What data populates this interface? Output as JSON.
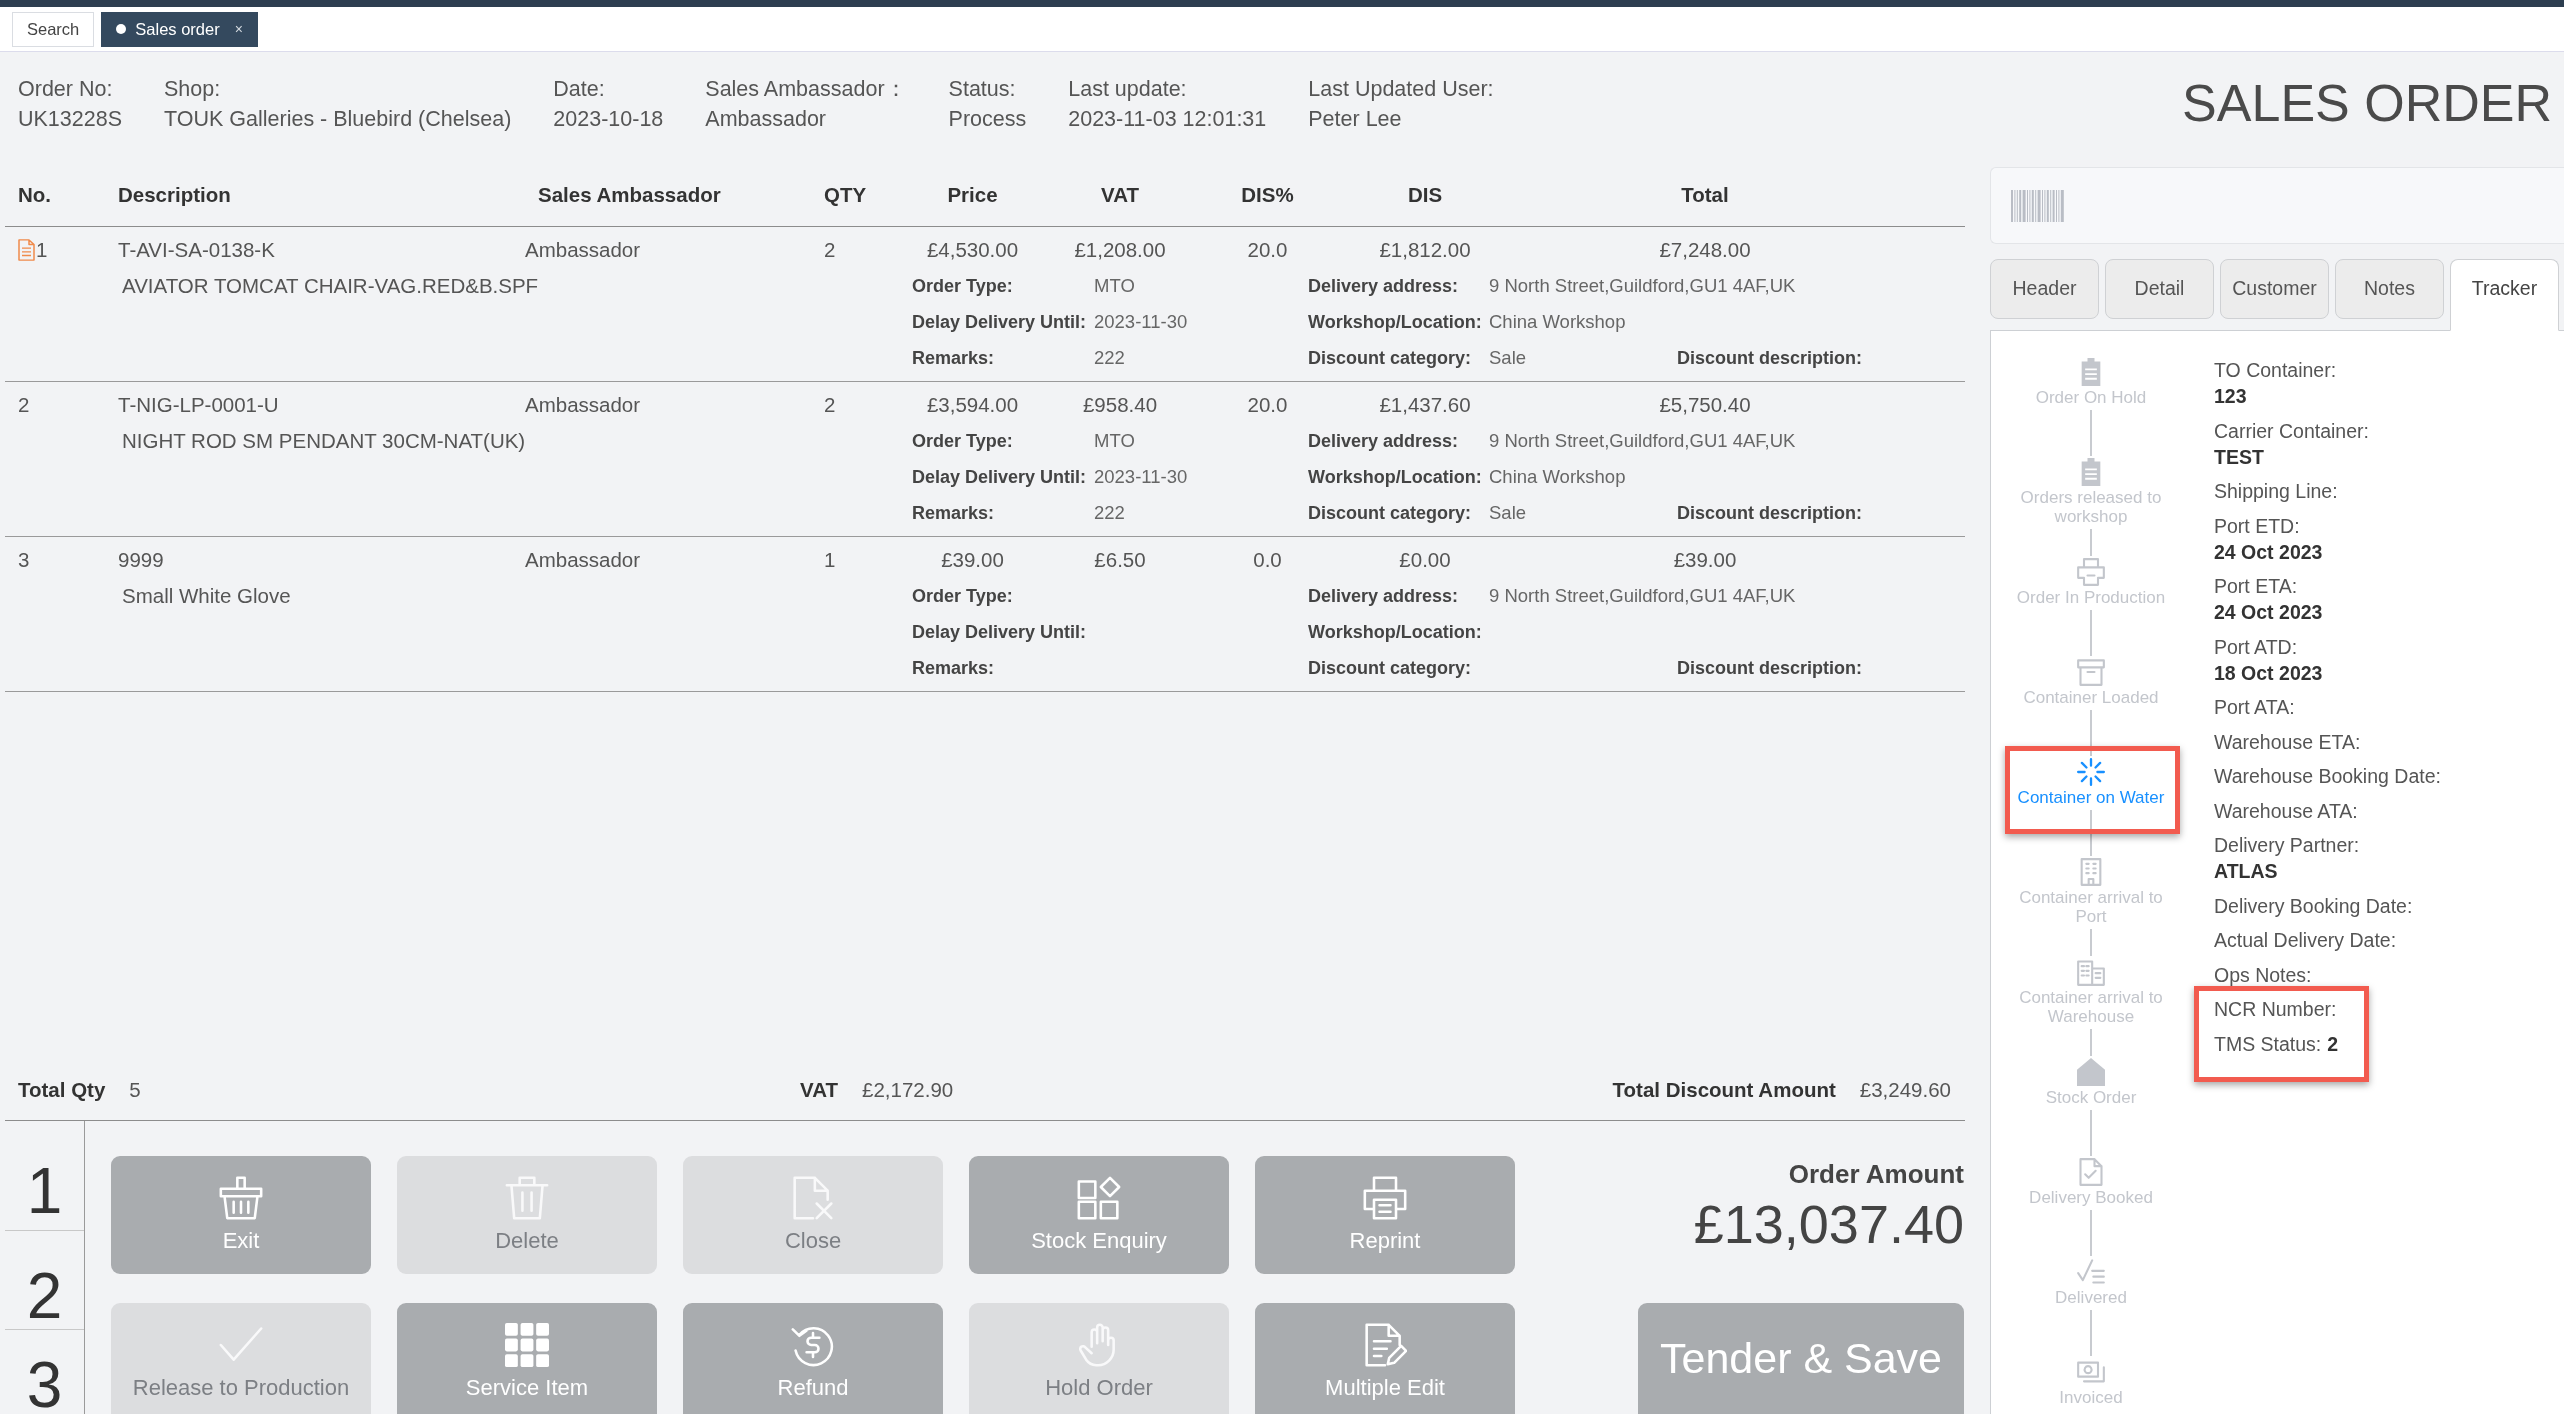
{
  "top_tabs": [
    {
      "label": "Search",
      "selected": false
    },
    {
      "label": "Sales order",
      "selected": true,
      "close": "×"
    }
  ],
  "header": {
    "fields": [
      {
        "label": "Order No:",
        "value": "UK13228S"
      },
      {
        "label": "Shop:",
        "value": "TOUK Galleries - Bluebird (Chelsea)"
      },
      {
        "label": "Date:",
        "value": "2023-10-18"
      },
      {
        "label": "Sales Ambassador：",
        "value": "Ambassador"
      },
      {
        "label": "Status:",
        "value": "Process"
      },
      {
        "label": "Last update:",
        "value": "2023-11-03 12:01:31"
      },
      {
        "label": "Last Updated User:",
        "value": "Peter Lee"
      }
    ],
    "title": "SALES ORDER"
  },
  "table": {
    "columns": [
      "No.",
      "Description",
      "Sales Ambassador",
      "QTY",
      "Price",
      "VAT",
      "DIS%",
      "DIS",
      "Total"
    ],
    "rows": [
      {
        "no": "1",
        "has_note": true,
        "code": "T-AVI-SA-0138-K",
        "description": "AVIATOR TOMCAT CHAIR-VAG.RED&B.SPF",
        "ambassador": "Ambassador",
        "qty": "2",
        "price": "£4,530.00",
        "vat": "£1,208.00",
        "dis_percent": "20.0",
        "dis": "£1,812.00",
        "total": "£7,248.00",
        "details": [
          [
            {
              "label": "Order Type:",
              "value": "MTO"
            },
            {
              "label": "Delivery address:",
              "value": "9 North Street,Guildford,GU1 4AF,UK"
            }
          ],
          [
            {
              "label": "Delay Delivery Until:",
              "value": "2023-11-30"
            },
            {
              "label": "Workshop/Location:",
              "value": "China Workshop"
            }
          ],
          [
            {
              "label": "Remarks:",
              "value": "222"
            },
            {
              "label": "Discount category:",
              "value": "Sale"
            },
            {
              "label": "Discount description:"
            }
          ]
        ]
      },
      {
        "no": "2",
        "has_note": false,
        "code": "T-NIG-LP-0001-U",
        "description": "NIGHT ROD SM PENDANT 30CM-NAT(UK)",
        "ambassador": "Ambassador",
        "qty": "2",
        "price": "£3,594.00",
        "vat": "£958.40",
        "dis_percent": "20.0",
        "dis": "£1,437.60",
        "total": "£5,750.40",
        "details": [
          [
            {
              "label": "Order Type:",
              "value": "MTO"
            },
            {
              "label": "Delivery address:",
              "value": "9 North Street,Guildford,GU1 4AF,UK"
            }
          ],
          [
            {
              "label": "Delay Delivery Until:",
              "value": "2023-11-30"
            },
            {
              "label": "Workshop/Location:",
              "value": "China Workshop"
            }
          ],
          [
            {
              "label": "Remarks:",
              "value": "222"
            },
            {
              "label": "Discount category:",
              "value": "Sale"
            },
            {
              "label": "Discount description:"
            }
          ]
        ]
      },
      {
        "no": "3",
        "has_note": false,
        "code": "9999",
        "description": "Small White Glove",
        "ambassador": "Ambassador",
        "qty": "1",
        "price": "£39.00",
        "vat": "£6.50",
        "dis_percent": "0.0",
        "dis": "£0.00",
        "total": "£39.00",
        "details": [
          [
            {
              "label": "Order Type:"
            },
            {
              "label": "Delivery address:",
              "value": "9 North Street,Guildford,GU1 4AF,UK"
            }
          ],
          [
            {
              "label": "Delay Delivery Until:"
            },
            {
              "label": "Workshop/Location:"
            }
          ],
          [
            {
              "label": "Remarks:"
            },
            {
              "label": "Discount category:"
            },
            {
              "label": "Discount description:"
            }
          ]
        ]
      }
    ]
  },
  "totals": [
    {
      "label": "Total Qty",
      "value": "5"
    },
    {
      "label": "VAT",
      "value": "£2,172.90"
    },
    {
      "label": "Total Discount Amount",
      "value": "£3,249.60"
    }
  ],
  "row_numbers": [
    "1",
    "2",
    "3"
  ],
  "action_rows": [
    [
      {
        "label": "Exit",
        "disabled": false
      },
      {
        "label": "Delete",
        "disabled": true
      },
      {
        "label": "Close",
        "disabled": true
      },
      {
        "label": "Stock Enquiry",
        "disabled": false
      },
      {
        "label": "Reprint",
        "disabled": false
      }
    ],
    [
      {
        "label": "Release to Production",
        "disabled": true
      },
      {
        "label": "Service Item",
        "disabled": false
      },
      {
        "label": "Refund",
        "disabled": false
      },
      {
        "label": "Hold Order",
        "disabled": true
      },
      {
        "label": "Multiple Edit",
        "disabled": false
      }
    ]
  ],
  "order_amount": {
    "label": "Order Amount",
    "value": "£13,037.40"
  },
  "tender_button": {
    "label": "Tender & Save",
    "disabled": false
  },
  "side_tabs": [
    {
      "label": "Header",
      "selected": false
    },
    {
      "label": "Detail",
      "selected": false
    },
    {
      "label": "Customer",
      "selected": false
    },
    {
      "label": "Notes",
      "selected": false
    },
    {
      "label": "Tracker",
      "selected": true
    }
  ],
  "tracker": {
    "steps": [
      {
        "label": "Order On Hold",
        "current": false,
        "highlighted": false
      },
      {
        "label": "Orders released to workshop",
        "current": false,
        "highlighted": false
      },
      {
        "label": "Order In Production",
        "current": false,
        "highlighted": false
      },
      {
        "label": "Container Loaded",
        "current": false,
        "highlighted": false
      },
      {
        "label": "Container on Water",
        "current": true,
        "highlighted": true
      },
      {
        "label": "Container arrival to Port",
        "current": false,
        "highlighted": false
      },
      {
        "label": "Container arrival to Warehouse",
        "current": false,
        "highlighted": false
      },
      {
        "label": "Stock Order",
        "current": false,
        "highlighted": false
      },
      {
        "label": "Delivery Booked",
        "current": false,
        "highlighted": false
      },
      {
        "label": "Delivered",
        "current": false,
        "highlighted": false
      },
      {
        "label": "Invoiced",
        "current": false,
        "highlighted": false
      }
    ],
    "fields": [
      {
        "kind": "stacked",
        "label": "TO Container:",
        "value": "123",
        "highlighted": false
      },
      {
        "kind": "stacked",
        "label": "Carrier Container:",
        "value": "TEST",
        "highlighted": false
      },
      {
        "kind": "stacked",
        "label": "Shipping Line:",
        "highlighted": false
      },
      {
        "kind": "stacked",
        "label": "Port ETD:",
        "value": "24 Oct 2023",
        "highlighted": false
      },
      {
        "kind": "stacked",
        "label": "Port ETA:",
        "value": "24 Oct 2023",
        "highlighted": false
      },
      {
        "kind": "stacked",
        "label": "Port ATD:",
        "value": "18 Oct 2023",
        "highlighted": false
      },
      {
        "kind": "stacked",
        "label": "Port ATA:",
        "highlighted": false
      },
      {
        "kind": "stacked",
        "label": "Warehouse ETA:",
        "highlighted": false
      },
      {
        "kind": "stacked",
        "label": "Warehouse Booking Date:",
        "highlighted": false
      },
      {
        "kind": "stacked",
        "label": "Warehouse ATA:",
        "highlighted": false
      },
      {
        "kind": "stacked",
        "label": "Delivery Partner:",
        "value": "ATLAS",
        "highlighted": false
      },
      {
        "kind": "stacked",
        "label": "Delivery Booking Date:",
        "highlighted": false
      },
      {
        "kind": "stacked",
        "label": "Actual Delivery Date:",
        "highlighted": false
      },
      {
        "kind": "stacked",
        "label": "Ops Notes:",
        "highlighted": false
      },
      {
        "kind": "stacked",
        "label": "NCR Number:",
        "highlighted": true
      },
      {
        "kind": "inline",
        "label": "TMS Status:",
        "value": "2",
        "highlighted": true
      }
    ]
  }
}
